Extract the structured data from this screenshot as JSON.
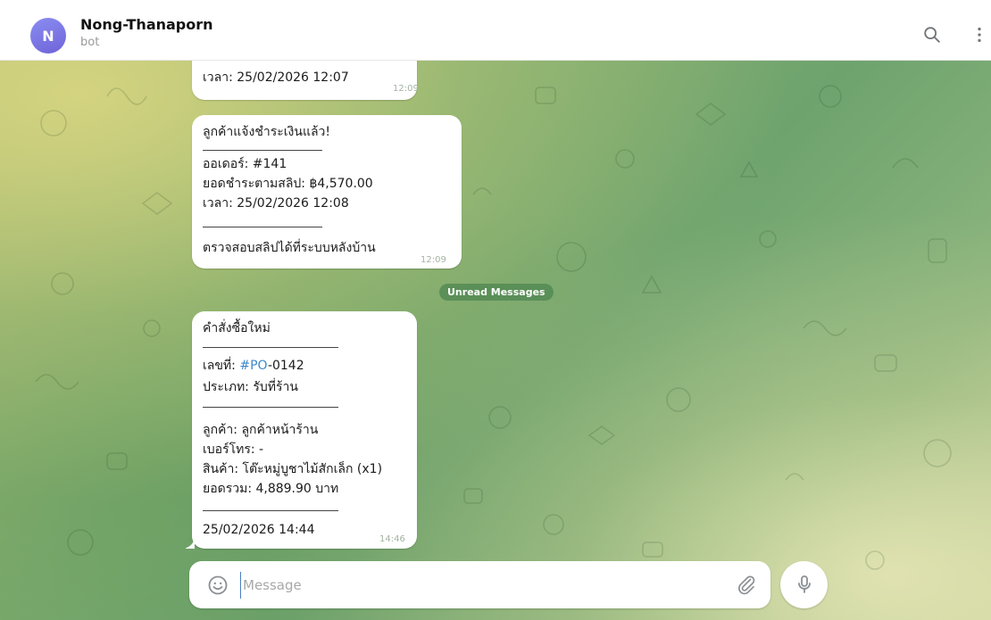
{
  "header": {
    "avatar_letter": "N",
    "title": "Nong-Thanaporn",
    "subtitle": "bot",
    "icons": [
      "search-icon",
      "more-vertical-icon"
    ]
  },
  "messages": [
    {
      "lines": [
        "เวลา: 25/02/2026 12:07"
      ],
      "time": "12:09"
    },
    {
      "lines": [
        "ลูกค้าแจ้งชำระเงินแล้ว!",
        "ออเดอร์: #141",
        "ยอดชำระตามสลิป: ฿4,570.00",
        "เวลา: 25/02/2026 12:08",
        "ตรวจสอบสลิปได้ที่ระบบหลังบ้าน"
      ],
      "time": "12:09"
    },
    {
      "lines": [
        "คำสั่งซื้อใหม่",
        "เลขที่: ",
        "#PO",
        "-0142",
        "ประเภท: รับที่ร้าน",
        "ลูกค้า: ลูกค้าหน้าร้าน",
        "เบอร์โทร: -",
        "สินค้า: โต๊ะหมู่บูชาไม้สักเล็ก (x1)",
        "ยอดรวม: 4,889.90 บาท",
        "25/02/2026 14:44"
      ],
      "time": "14:46"
    }
  ],
  "unread_label": "Unread Messages",
  "composer": {
    "placeholder": "Message",
    "icons": [
      "emoji-icon",
      "paperclip-icon",
      "microphone-icon"
    ]
  },
  "colors": {
    "accent": "#3e88c9",
    "avatar": "#7a72e6",
    "unread_badge": "#4e8550"
  }
}
